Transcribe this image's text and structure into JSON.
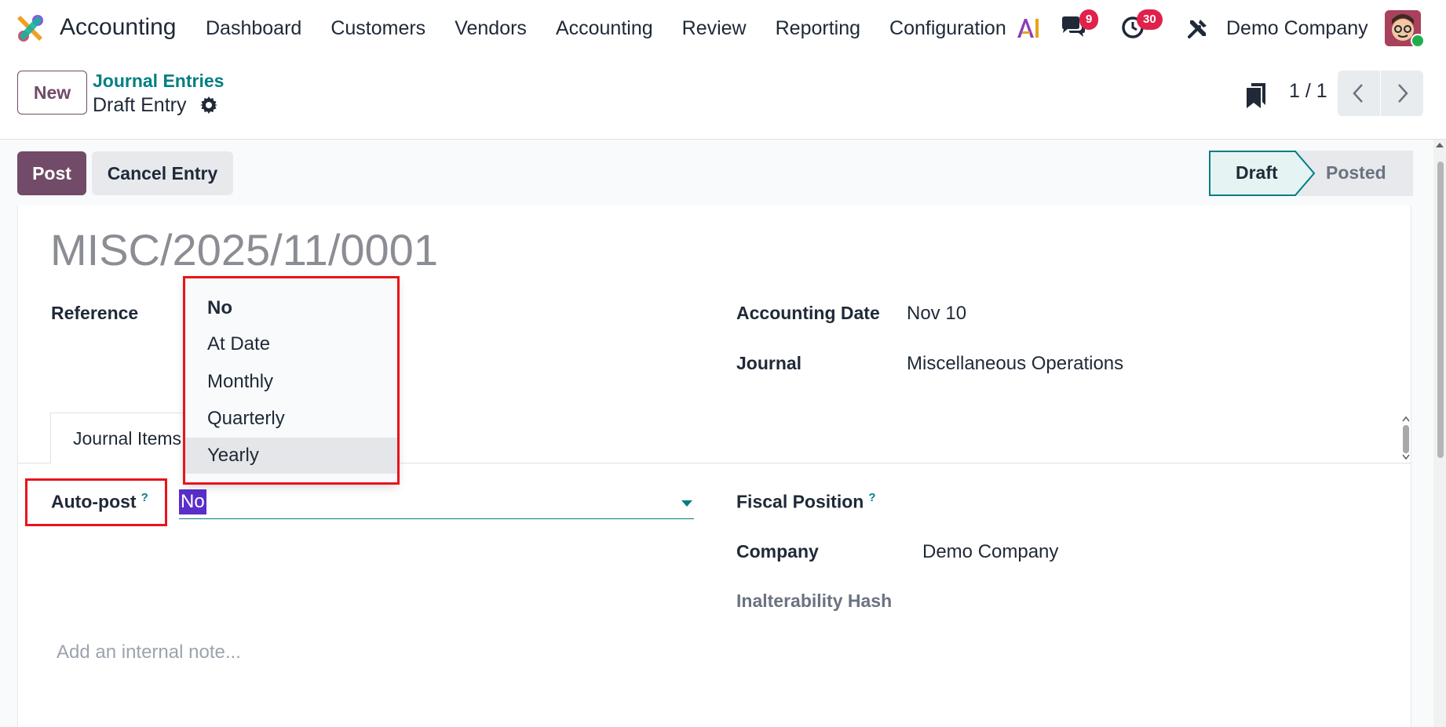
{
  "navbar": {
    "app_name": "Accounting",
    "menu": [
      "Dashboard",
      "Customers",
      "Vendors",
      "Accounting",
      "Review",
      "Reporting",
      "Configuration"
    ],
    "messages_count": "9",
    "activities_count": "30",
    "company": "Demo Company"
  },
  "control_panel": {
    "new_label": "New",
    "breadcrumb_parent": "Journal Entries",
    "breadcrumb_current": "Draft Entry",
    "pager": "1 / 1"
  },
  "statusbar": {
    "post_label": "Post",
    "cancel_label": "Cancel Entry",
    "stages": [
      "Draft",
      "Posted"
    ],
    "active_stage": "Draft"
  },
  "form": {
    "entry_name": "MISC/2025/11/0001",
    "reference_label": "Reference",
    "accounting_date_label": "Accounting Date",
    "accounting_date_value": "Nov 10",
    "journal_label": "Journal",
    "journal_value": "Miscellaneous Operations",
    "tab_label": "Journal Items",
    "autopost_label": "Auto-post",
    "autopost_value": "No",
    "fiscal_position_label": "Fiscal Position",
    "company_label": "Company",
    "company_value": "Demo Company",
    "hash_label": "Inalterability Hash",
    "note_placeholder": "Add an internal note...",
    "help_mark": "?"
  },
  "dropdown": {
    "options": [
      "No",
      "At Date",
      "Monthly",
      "Quarterly",
      "Yearly"
    ],
    "selected": "No",
    "hovered": "Yearly"
  },
  "colors": {
    "brand": "#714b67",
    "teal": "#017e84",
    "badge": "#e0214b",
    "highlight_red": "#e8141b",
    "selection": "#5a2ec9"
  }
}
